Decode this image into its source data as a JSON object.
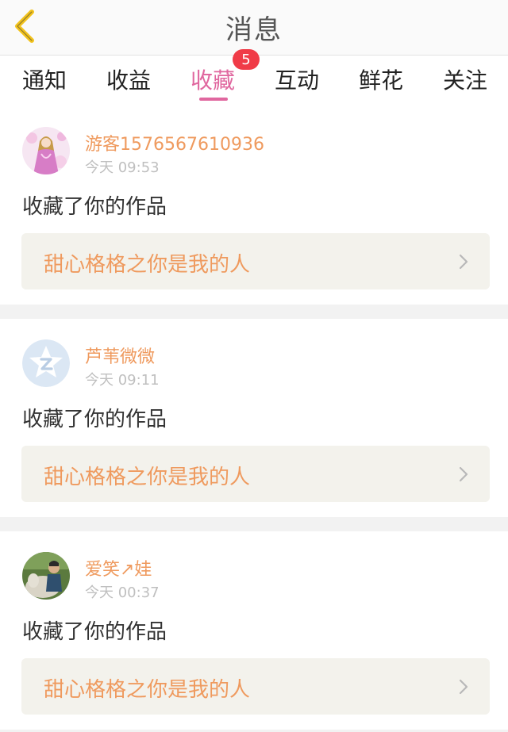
{
  "header": {
    "title": "消息",
    "back_icon": "chevron-left-icon",
    "accent_color": "#f2c21b"
  },
  "tabs": [
    {
      "label": "通知"
    },
    {
      "label": "收益"
    },
    {
      "label": "收藏",
      "active": true,
      "badge": "5"
    },
    {
      "label": "互动"
    },
    {
      "label": "鲜花"
    },
    {
      "label": "关注"
    }
  ],
  "colors": {
    "active_tab": "#e0679f",
    "badge": "#f03b47",
    "username": "#ef9a5e",
    "timestamp": "#bfbfbf",
    "work_link_bg": "#f3f2ec"
  },
  "messages": [
    {
      "avatar_icon": "user-avatar-image",
      "username": "游客1576567610936",
      "time": "今天 09:53",
      "action": "收藏了你的作品",
      "work_title": "甜心格格之你是我的人"
    },
    {
      "avatar_icon": "default-avatar-icon",
      "username": "芦苇微微",
      "time": "今天 09:11",
      "action": "收藏了你的作品",
      "work_title": "甜心格格之你是我的人"
    },
    {
      "avatar_icon": "user-avatar-image",
      "username": "爱笑↗娃",
      "time": "今天 00:37",
      "action": "收藏了你的作品",
      "work_title": "甜心格格之你是我的人"
    }
  ]
}
